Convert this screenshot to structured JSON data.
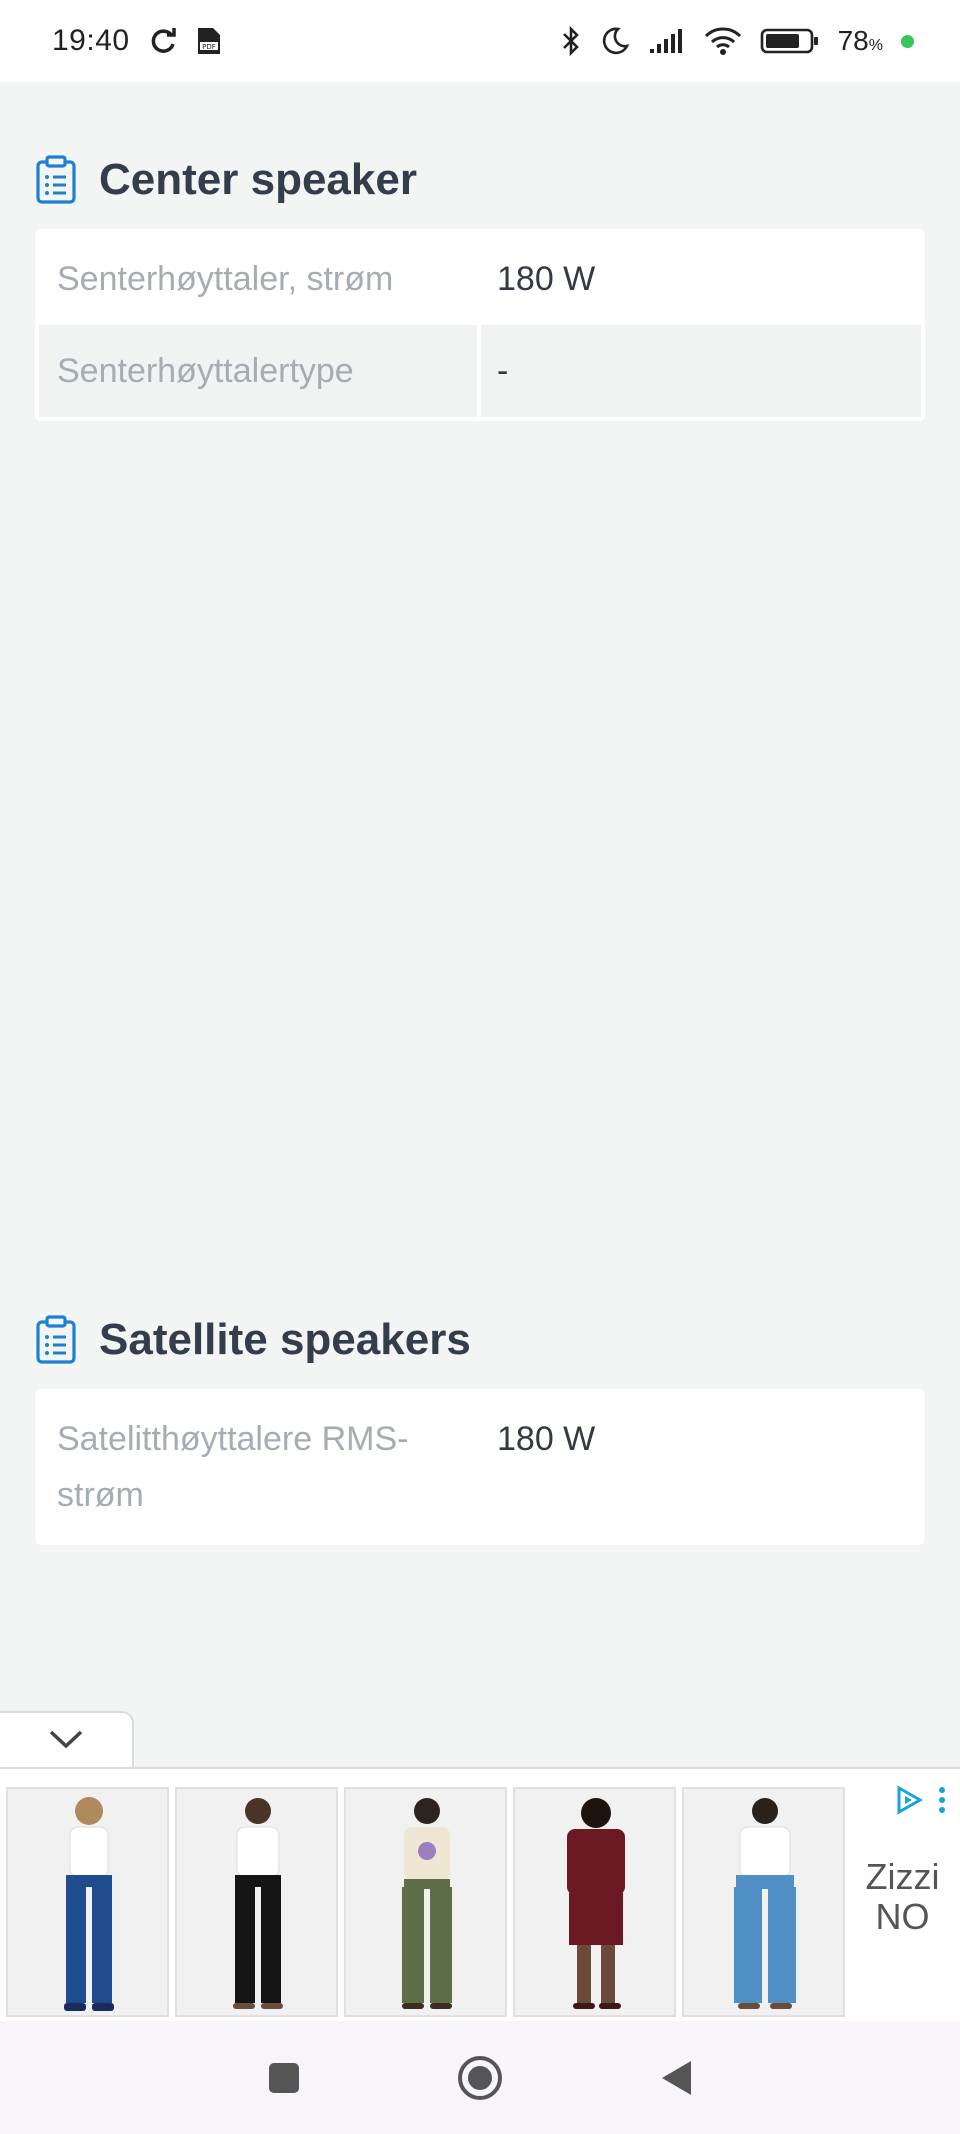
{
  "status_bar": {
    "time": "19:40",
    "battery": "78",
    "battery_unit": "%",
    "icons": [
      "sync-icon",
      "pdf-icon",
      "bluetooth-icon",
      "moon-icon",
      "signal-icon",
      "wifi-icon",
      "battery-icon"
    ]
  },
  "sections": [
    {
      "title": "Center speaker",
      "icon": "clipboard-list-icon",
      "rows": [
        {
          "label": "Senterhøyttaler, strøm",
          "value": "180 W"
        },
        {
          "label": "Senterhøyttalertype",
          "value": "-"
        }
      ]
    },
    {
      "title": "Satellite speakers",
      "icon": "clipboard-list-icon",
      "rows": [
        {
          "label": "Satelitthøyttalere RMS-strøm",
          "value": "180 W"
        }
      ]
    }
  ],
  "ad": {
    "brand": "Zizzi NO",
    "collapse_icon": "chevron-down-icon",
    "products": [
      {
        "color_top": "#ffffff",
        "color_bottom": "#1f4c8f"
      },
      {
        "color_top": "#ffffff",
        "color_bottom": "#151515"
      },
      {
        "color_top": "#efe6d3",
        "color_bottom": "#5e6f48"
      },
      {
        "color_top": "#6b1a24",
        "color_bottom": "#6b1a24"
      },
      {
        "color_top": "#ffffff",
        "color_bottom": "#4f8fc4"
      }
    ]
  },
  "nav": {
    "buttons": [
      "recents-button",
      "home-button",
      "back-button"
    ]
  },
  "colors": {
    "accent": "#1e7fd0",
    "title": "#343d4b",
    "label": "#a5acb3",
    "background": "#f3f5f4"
  }
}
